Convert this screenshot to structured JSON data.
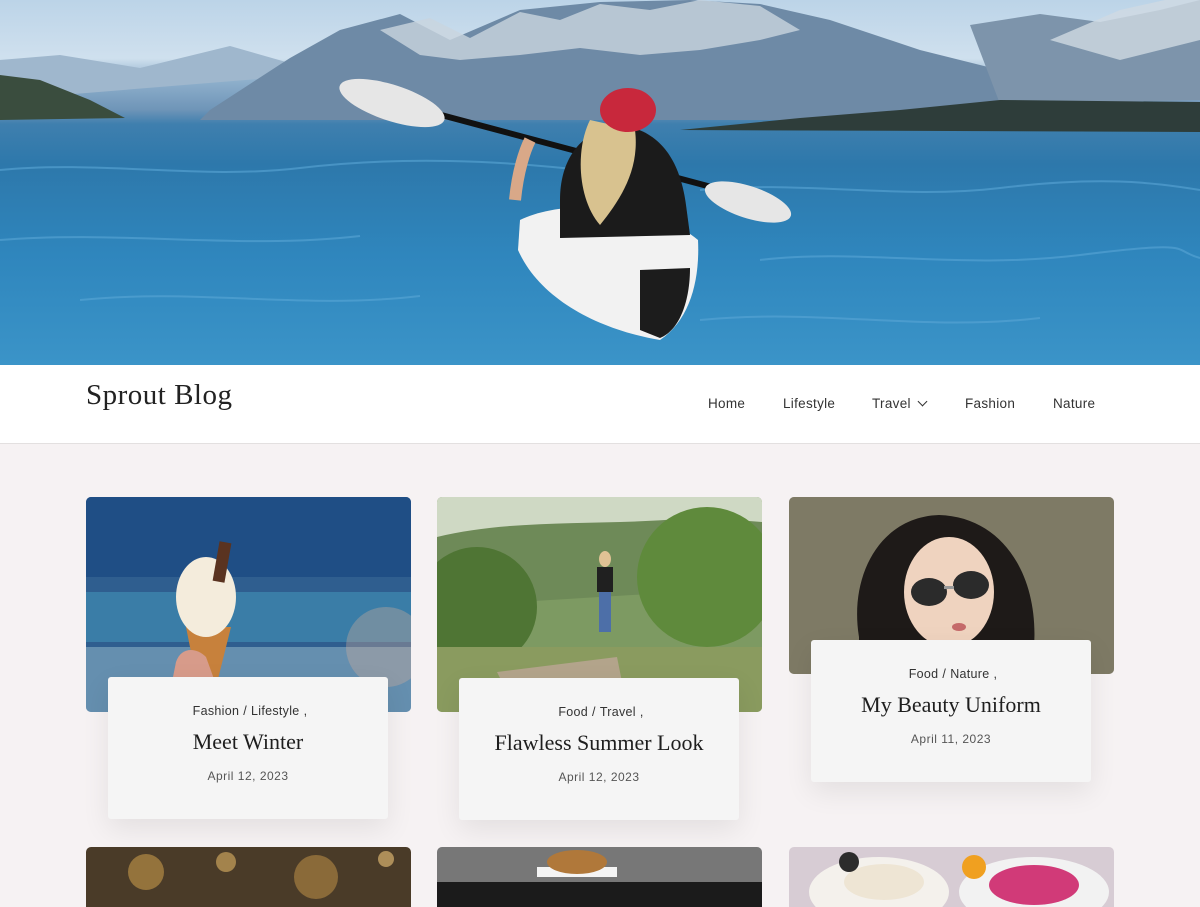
{
  "site": {
    "title": "Sprout Blog"
  },
  "nav": {
    "items": [
      {
        "label": "Home"
      },
      {
        "label": "Lifestyle"
      },
      {
        "label": "Travel",
        "has_dropdown": true
      },
      {
        "label": "Fashion"
      },
      {
        "label": "Nature"
      }
    ]
  },
  "posts": [
    {
      "categories": [
        "Fashion",
        "Lifestyle"
      ],
      "title": "Meet Winter",
      "date": "April 12, 2023"
    },
    {
      "categories": [
        "Food",
        "Travel"
      ],
      "title": "Flawless Summer Look",
      "date": "April 12, 2023"
    },
    {
      "categories": [
        "Food",
        "Nature"
      ],
      "title": "My Beauty Uniform",
      "date": "April 11, 2023"
    }
  ],
  "colors": {
    "background": "#f6f2f3",
    "header_bg": "#ffffff",
    "card_bg": "#f5f5f5",
    "text": "#222222"
  }
}
